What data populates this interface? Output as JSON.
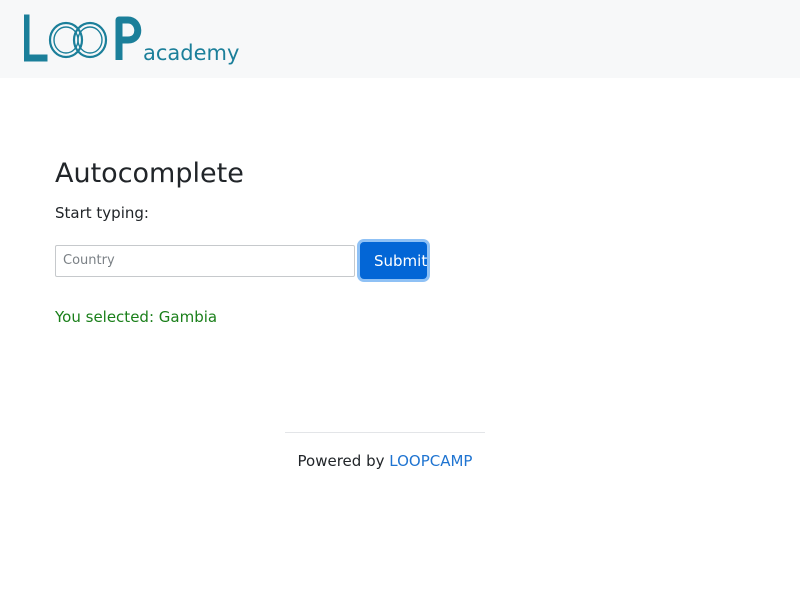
{
  "header": {
    "logo": {
      "text_main": "LOOP",
      "text_sub": "academy",
      "color": "#1b7f9a"
    }
  },
  "main": {
    "title": "Autocomplete",
    "instruction": "Start typing:",
    "input": {
      "placeholder": "Country",
      "value": ""
    },
    "submit_label": "Submit",
    "result_text": "You selected: Gambia"
  },
  "footer": {
    "powered_by": "Powered by",
    "link_text": "LOOPCAMP"
  },
  "colors": {
    "accent": "#0366d6",
    "success": "#1a7f1a",
    "link": "#1f74d1"
  }
}
